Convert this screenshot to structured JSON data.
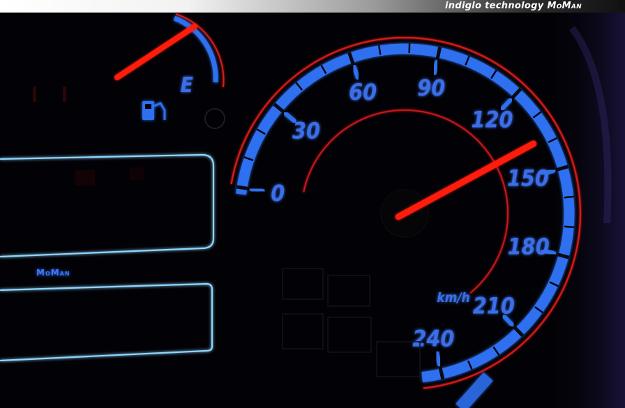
{
  "header": {
    "brand_text": "indiglo technology",
    "brand_name": "MoMan"
  },
  "fuel_gauge": {
    "empty_mark": "E",
    "icon": "fuel-pump-icon"
  },
  "speedometer": {
    "unit": "km/h",
    "ticks": [
      "0",
      "30",
      "60",
      "90",
      "120",
      "150",
      "180",
      "210",
      "240"
    ],
    "needle_value": 138
  },
  "panel": {
    "logo_text": "MoMan"
  },
  "colors": {
    "blue_glow": "#2f6ff0",
    "needle_red": "#ff1a10",
    "panel_edge": "#8fd6ff"
  }
}
